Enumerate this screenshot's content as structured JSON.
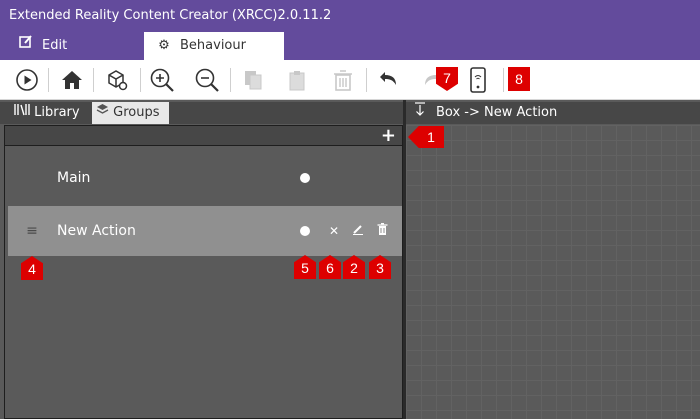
{
  "window": {
    "title": "Extended Reality Content Creator (XRCC)2.0.11.2"
  },
  "tabs": [
    {
      "label": "Edit",
      "icon": "edit-icon"
    },
    {
      "label": "Behaviour",
      "icon": "gear-icon",
      "active": true
    }
  ],
  "toolbar": {
    "buttons": [
      {
        "name": "play",
        "icon": "play-icon"
      },
      {
        "name": "home",
        "icon": "home-icon"
      },
      {
        "name": "settings",
        "icon": "cube-gear-icon"
      },
      {
        "name": "zoom-in",
        "icon": "zoom-in-icon"
      },
      {
        "name": "zoom-out",
        "icon": "zoom-out-icon"
      },
      {
        "name": "copy",
        "icon": "copy-icon",
        "disabled": true
      },
      {
        "name": "paste",
        "icon": "paste-icon",
        "disabled": true
      },
      {
        "name": "delete",
        "icon": "trash-icon",
        "disabled": true
      },
      {
        "name": "undo",
        "icon": "undo-icon"
      },
      {
        "name": "redo",
        "icon": "redo-icon",
        "disabled": true
      },
      {
        "name": "device",
        "icon": "phone-icon"
      }
    ]
  },
  "left_panel": {
    "tabs": [
      {
        "label": "Library",
        "icon": "library-icon"
      },
      {
        "label": "Groups",
        "icon": "layers-icon",
        "active": true
      }
    ],
    "groups": [
      {
        "label": "Main"
      },
      {
        "label": "New Action",
        "selected": true
      }
    ]
  },
  "right_panel": {
    "path": "Box -> New Action"
  },
  "annotations": [
    "1",
    "2",
    "3",
    "4",
    "5",
    "6",
    "7",
    "8"
  ],
  "colors": {
    "titlebar": "#634b9c",
    "badge": "#dd0000",
    "panel": "#5a5a5a",
    "selected_row": "#909090"
  }
}
